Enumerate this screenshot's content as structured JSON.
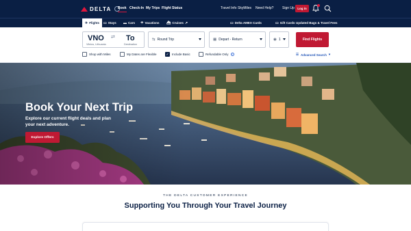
{
  "brand": {
    "name": "DELTA"
  },
  "topnav": {
    "links": [
      "Book",
      "Check-In",
      "My Trips",
      "Flight Status"
    ],
    "utility": [
      "Travel Info",
      "SkyMiles",
      "Need Help?",
      "Sign Up"
    ],
    "login_label": "Log in"
  },
  "subnav": {
    "tabs": [
      "Flights",
      "Stays",
      "Cars",
      "Vacations",
      "Cruises"
    ],
    "promos": [
      "Delta AMEX Cards",
      "Gift Cards",
      "Updated Bags & Travel Fees"
    ]
  },
  "booking": {
    "origin_code": "VNO",
    "origin_city": "Vilnius, Lithuania",
    "dest_code": "To",
    "dest_label": "Destination",
    "trip_type": "Round Trip",
    "dates": "Depart - Return",
    "passengers": "1",
    "find_label": "Find Flights",
    "options": [
      {
        "label": "Shop with Miles",
        "checked": false
      },
      {
        "label": "My Dates are Flexible",
        "checked": false
      },
      {
        "label": "Include Basic",
        "checked": true
      },
      {
        "label": "Refundable Only",
        "checked": false
      }
    ],
    "advanced_label": "Advanced Search"
  },
  "hero": {
    "title": "Book Your Next Trip",
    "subtitle": "Explore our current flight deals and plan your next adventure.",
    "cta": "Explore Offers"
  },
  "section": {
    "eyebrow": "THE DELTA CUSTOMER EXPERIENCE",
    "title": "Supporting You Through Your Travel Journey"
  },
  "colors": {
    "navy": "#0a1f44",
    "red": "#c01933",
    "accent_red": "#e0173d",
    "link_blue": "#1a4fb5"
  }
}
